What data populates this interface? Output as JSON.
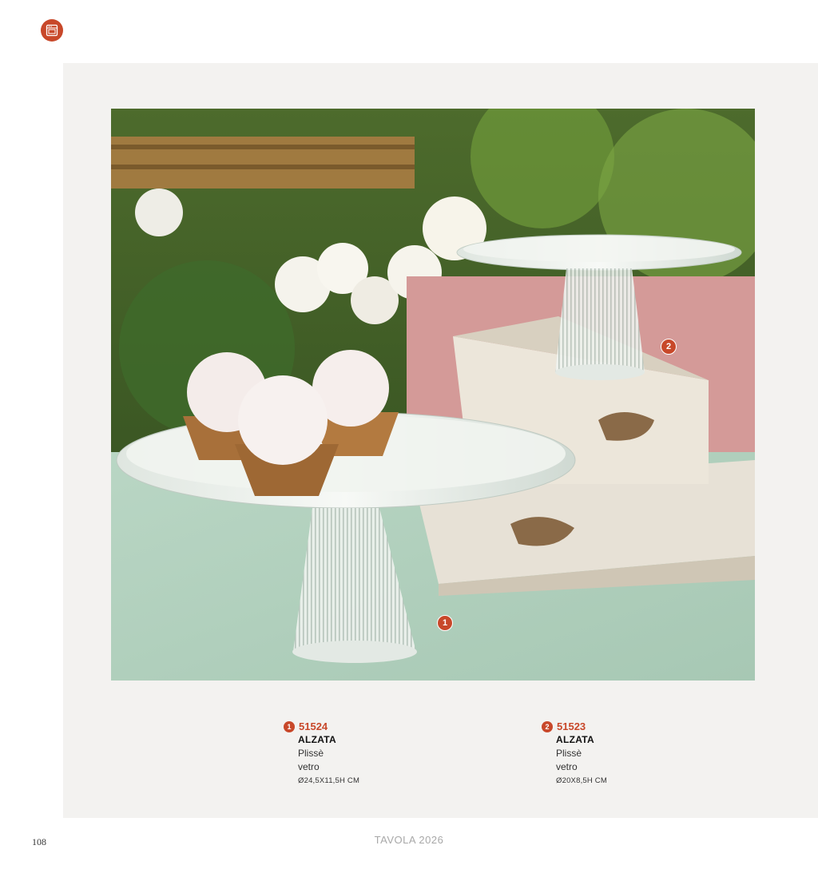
{
  "header": {
    "logo_icon": "oven-icon",
    "accent": "#c8482a"
  },
  "photo": {
    "description_icon": "cake-stands-photo"
  },
  "markers": [
    "1",
    "2"
  ],
  "products": [
    {
      "number": "1",
      "code": "51524",
      "name": "ALZATA",
      "line1": "Plissè",
      "line2": "vetro",
      "dimensions": "Ø24,5X11,5H CM"
    },
    {
      "number": "2",
      "code": "51523",
      "name": "ALZATA",
      "line1": "Plissè",
      "line2": "vetro",
      "dimensions": "Ø20X8,5H CM"
    }
  ],
  "footer": {
    "page_number": "108",
    "catalog_title": "TAVOLA 2026"
  }
}
